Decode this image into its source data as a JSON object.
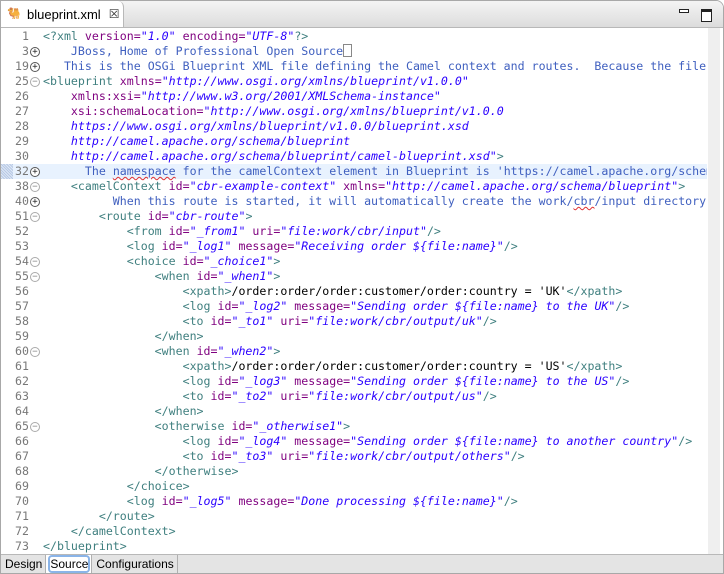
{
  "editor_tab": {
    "title": "blueprint.xml",
    "icon": "camel-icon",
    "close_icon": "close-icon"
  },
  "window_controls": {
    "minimize": "minimize-icon",
    "maximize": "maximize-icon"
  },
  "colors": {
    "tag": "#3f7f7f",
    "attribute": "#7f007f",
    "value": "#2a00ff",
    "comment": "#3f5fbf",
    "highlight": "#e8f2fe"
  },
  "lines": [
    {
      "n": "1",
      "fold": "",
      "segs": [
        [
          "t",
          "<?xml"
        ],
        [
          "a",
          " version="
        ],
        [
          "v",
          "\"1.0\""
        ],
        [
          "a",
          " encoding="
        ],
        [
          "v",
          "\"UTF-8\""
        ],
        [
          "t",
          "?>"
        ]
      ]
    },
    {
      "n": "3",
      "fold": "plus",
      "collapsed": true,
      "segs": [
        [
          "c",
          "    JBoss, Home of Professional Open Source"
        ]
      ]
    },
    {
      "n": "19",
      "fold": "plus",
      "segs": [
        [
          "c",
          "   This is the OSGi Blueprint XML file defining the Camel context and routes.  Because the file"
        ]
      ]
    },
    {
      "n": "25",
      "fold": "minus",
      "segs": [
        [
          "t",
          "<blueprint"
        ],
        [
          "a",
          " xmlns="
        ],
        [
          "v",
          "\"http://www.osgi.org/xmlns/blueprint/v1.0.0\""
        ]
      ]
    },
    {
      "n": "26",
      "fold": "",
      "segs": [
        [
          "a",
          "    xmlns:xsi="
        ],
        [
          "v",
          "\"http://www.w3.org/2001/XMLSchema-instance\""
        ]
      ]
    },
    {
      "n": "27",
      "fold": "",
      "segs": [
        [
          "a",
          "    xsi:schemaLocation="
        ],
        [
          "v",
          "\"http://www.osgi.org/xmlns/blueprint/v1.0.0"
        ]
      ]
    },
    {
      "n": "28",
      "fold": "",
      "segs": [
        [
          "v",
          "    https://www.osgi.org/xmlns/blueprint/v1.0.0/blueprint.xsd"
        ]
      ]
    },
    {
      "n": "29",
      "fold": "",
      "segs": [
        [
          "v",
          "    http://camel.apache.org/schema/blueprint"
        ]
      ]
    },
    {
      "n": "30",
      "fold": "",
      "segs": [
        [
          "v",
          "    http://camel.apache.org/schema/blueprint/camel-blueprint.xsd\""
        ],
        [
          "t",
          ">"
        ]
      ]
    },
    {
      "n": "32",
      "fold": "plus",
      "highlight": true,
      "segs": [
        [
          "c",
          "      The "
        ],
        [
          "cu",
          "namespace"
        ],
        [
          "c",
          " for the camelContext element in Blueprint is 'https://camel.apache.org/schem"
        ]
      ]
    },
    {
      "n": "38",
      "fold": "minus",
      "segs": [
        [
          "t",
          "    <camelContext"
        ],
        [
          "a",
          " id="
        ],
        [
          "v",
          "\"cbr-example-context\""
        ],
        [
          "a",
          " xmlns="
        ],
        [
          "v",
          "\"http://camel.apache.org/schema/blueprint\""
        ],
        [
          "t",
          ">"
        ]
      ]
    },
    {
      "n": "40",
      "fold": "plus",
      "segs": [
        [
          "c",
          "          When this route is started, it will automatically create the work/"
        ],
        [
          "cu",
          "cbr"
        ],
        [
          "c",
          "/input directory"
        ]
      ]
    },
    {
      "n": "51",
      "fold": "minus",
      "segs": [
        [
          "t",
          "        <route"
        ],
        [
          "a",
          " id="
        ],
        [
          "v",
          "\"cbr-route\""
        ],
        [
          "t",
          ">"
        ]
      ]
    },
    {
      "n": "52",
      "fold": "",
      "segs": [
        [
          "t",
          "            <from"
        ],
        [
          "a",
          " id="
        ],
        [
          "v",
          "\"_from1\""
        ],
        [
          "a",
          " uri="
        ],
        [
          "v",
          "\"file:work/cbr/input\""
        ],
        [
          "t",
          "/>"
        ]
      ]
    },
    {
      "n": "53",
      "fold": "",
      "segs": [
        [
          "t",
          "            <log"
        ],
        [
          "a",
          " id="
        ],
        [
          "v",
          "\"_log1\""
        ],
        [
          "a",
          " message="
        ],
        [
          "v",
          "\"Receiving order ${file:name}\""
        ],
        [
          "t",
          "/>"
        ]
      ]
    },
    {
      "n": "54",
      "fold": "minus",
      "segs": [
        [
          "t",
          "            <choice"
        ],
        [
          "a",
          " id="
        ],
        [
          "v",
          "\"_choice1\""
        ],
        [
          "t",
          ">"
        ]
      ]
    },
    {
      "n": "55",
      "fold": "minus",
      "segs": [
        [
          "t",
          "                <when"
        ],
        [
          "a",
          " id="
        ],
        [
          "v",
          "\"_when1\""
        ],
        [
          "t",
          ">"
        ]
      ]
    },
    {
      "n": "56",
      "fold": "",
      "segs": [
        [
          "t",
          "                    <xpath>"
        ],
        [
          "p",
          "/order:order/order:customer/order:country = 'UK'"
        ],
        [
          "t",
          "</xpath>"
        ]
      ]
    },
    {
      "n": "57",
      "fold": "",
      "segs": [
        [
          "t",
          "                    <log"
        ],
        [
          "a",
          " id="
        ],
        [
          "v",
          "\"_log2\""
        ],
        [
          "a",
          " message="
        ],
        [
          "v",
          "\"Sending order ${file:name} to the UK\""
        ],
        [
          "t",
          "/>"
        ]
      ]
    },
    {
      "n": "58",
      "fold": "",
      "segs": [
        [
          "t",
          "                    <to"
        ],
        [
          "a",
          " id="
        ],
        [
          "v",
          "\"_to1\""
        ],
        [
          "a",
          " uri="
        ],
        [
          "v",
          "\"file:work/cbr/output/uk\""
        ],
        [
          "t",
          "/>"
        ]
      ]
    },
    {
      "n": "59",
      "fold": "",
      "segs": [
        [
          "t",
          "                </when>"
        ]
      ]
    },
    {
      "n": "60",
      "fold": "minus",
      "segs": [
        [
          "t",
          "                <when"
        ],
        [
          "a",
          " id="
        ],
        [
          "v",
          "\"_when2\""
        ],
        [
          "t",
          ">"
        ]
      ]
    },
    {
      "n": "61",
      "fold": "",
      "segs": [
        [
          "t",
          "                    <xpath>"
        ],
        [
          "p",
          "/order:order/order:customer/order:country = 'US'"
        ],
        [
          "t",
          "</xpath>"
        ]
      ]
    },
    {
      "n": "62",
      "fold": "",
      "segs": [
        [
          "t",
          "                    <log"
        ],
        [
          "a",
          " id="
        ],
        [
          "v",
          "\"_log3\""
        ],
        [
          "a",
          " message="
        ],
        [
          "v",
          "\"Sending order ${file:name} to the US\""
        ],
        [
          "t",
          "/>"
        ]
      ]
    },
    {
      "n": "63",
      "fold": "",
      "segs": [
        [
          "t",
          "                    <to"
        ],
        [
          "a",
          " id="
        ],
        [
          "v",
          "\"_to2\""
        ],
        [
          "a",
          " uri="
        ],
        [
          "v",
          "\"file:work/cbr/output/us\""
        ],
        [
          "t",
          "/>"
        ]
      ]
    },
    {
      "n": "64",
      "fold": "",
      "segs": [
        [
          "t",
          "                </when>"
        ]
      ]
    },
    {
      "n": "65",
      "fold": "minus",
      "segs": [
        [
          "t",
          "                <otherwise"
        ],
        [
          "a",
          " id="
        ],
        [
          "v",
          "\"_otherwise1\""
        ],
        [
          "t",
          ">"
        ]
      ]
    },
    {
      "n": "66",
      "fold": "",
      "segs": [
        [
          "t",
          "                    <log"
        ],
        [
          "a",
          " id="
        ],
        [
          "v",
          "\"_log4\""
        ],
        [
          "a",
          " message="
        ],
        [
          "v",
          "\"Sending order ${file:name} to another country\""
        ],
        [
          "t",
          "/>"
        ]
      ]
    },
    {
      "n": "67",
      "fold": "",
      "segs": [
        [
          "t",
          "                    <to"
        ],
        [
          "a",
          " id="
        ],
        [
          "v",
          "\"_to3\""
        ],
        [
          "a",
          " uri="
        ],
        [
          "v",
          "\"file:work/cbr/output/others\""
        ],
        [
          "t",
          "/>"
        ]
      ]
    },
    {
      "n": "68",
      "fold": "",
      "segs": [
        [
          "t",
          "                </otherwise>"
        ]
      ]
    },
    {
      "n": "69",
      "fold": "",
      "segs": [
        [
          "t",
          "            </choice>"
        ]
      ]
    },
    {
      "n": "70",
      "fold": "",
      "segs": [
        [
          "t",
          "            <log"
        ],
        [
          "a",
          " id="
        ],
        [
          "v",
          "\"_log5\""
        ],
        [
          "a",
          " message="
        ],
        [
          "v",
          "\"Done processing ${file:name}\""
        ],
        [
          "t",
          "/>"
        ]
      ]
    },
    {
      "n": "71",
      "fold": "",
      "segs": [
        [
          "t",
          "        </route>"
        ]
      ]
    },
    {
      "n": "72",
      "fold": "",
      "segs": [
        [
          "t",
          "    </camelContext>"
        ]
      ]
    },
    {
      "n": "73",
      "fold": "",
      "segs": [
        [
          "t",
          "</blueprint>"
        ]
      ]
    }
  ],
  "bottom_tabs": [
    {
      "label": "Design",
      "active": false
    },
    {
      "label": "Source",
      "active": true
    },
    {
      "label": "Configurations",
      "active": false
    }
  ]
}
